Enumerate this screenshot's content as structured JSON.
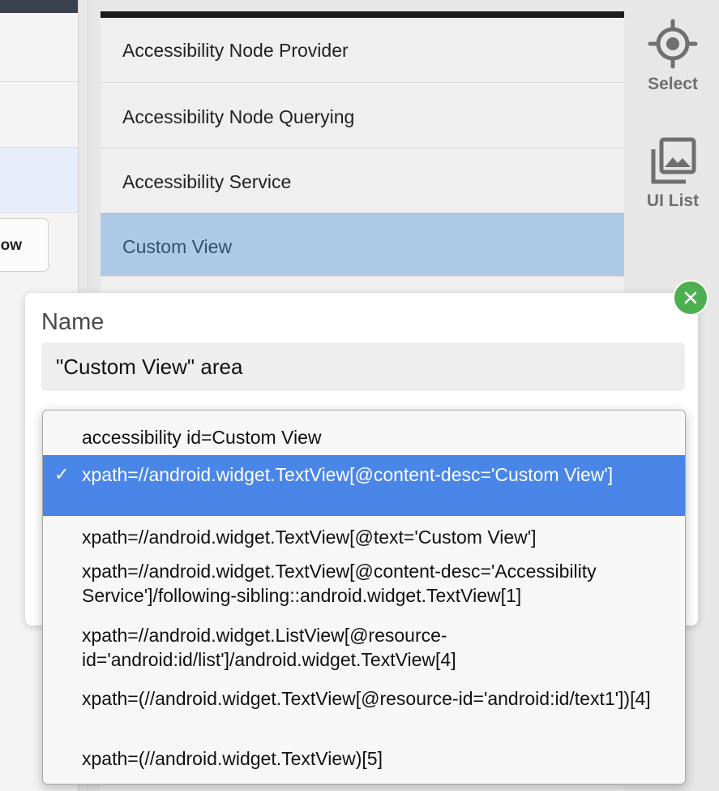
{
  "left": {
    "button_label": "ow"
  },
  "screen": {
    "items": [
      {
        "label": "Accessibility Node Provider"
      },
      {
        "label": "Accessibility Node Querying"
      },
      {
        "label": "Accessibility Service"
      },
      {
        "label": "Custom View"
      }
    ]
  },
  "tools": {
    "select_label": "Select",
    "uilist_label": "UI List"
  },
  "dialog": {
    "name_label": "Name",
    "name_value": "\"Custom View\" area"
  },
  "dropdown": {
    "selected_index": 1,
    "options": [
      "accessibility id=Custom View",
      "xpath=//android.widget.TextView[@content-desc='Custom View']",
      "xpath=//android.widget.TextView[@text='Custom View']",
      "xpath=//android.widget.TextView[@content-desc='Accessibility Service']/following-sibling::android.widget.TextView[1]",
      "xpath=//android.widget.ListView[@resource-id='android:id/list']/android.widget.TextView[4]",
      "xpath=(//android.widget.TextView[@resource-id='android:id/text1'])[4]",
      "xpath=(//android.widget.TextView)[5]"
    ],
    "check_glyph": "✓"
  },
  "colors": {
    "selected_option": "#4a86e8",
    "selected_list_item": "#aec9e6",
    "close_button": "#4caf50"
  },
  "icons": [
    "crosshair-icon",
    "image-stack-icon",
    "close-icon",
    "checkmark-icon"
  ]
}
